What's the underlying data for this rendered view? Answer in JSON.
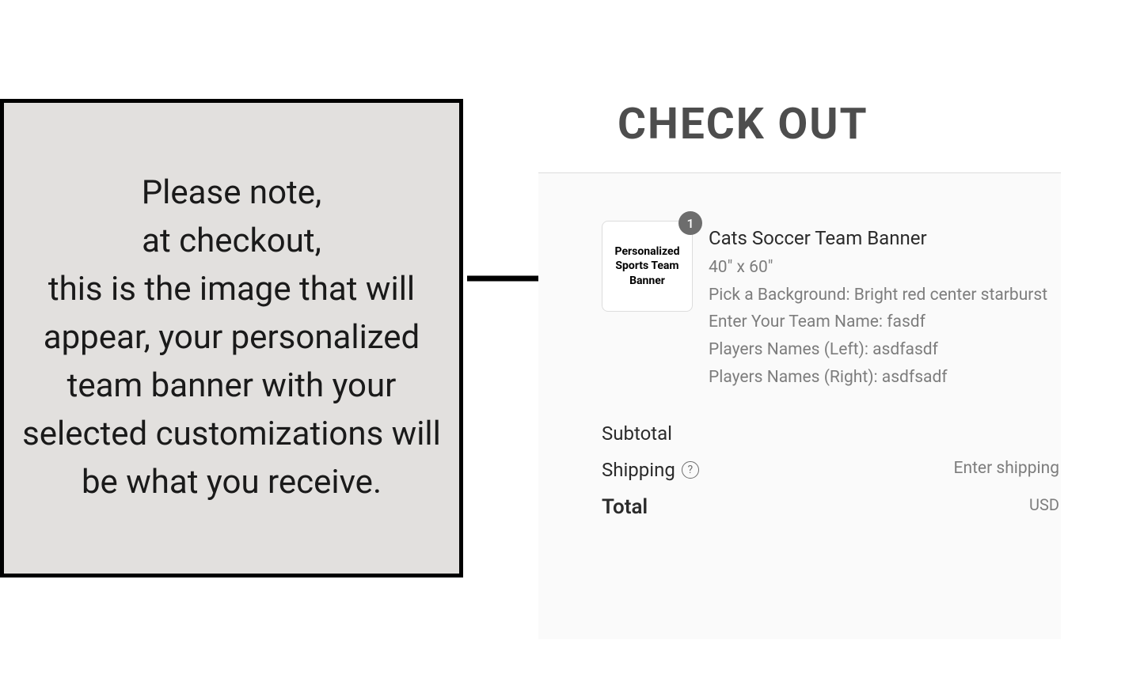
{
  "note": {
    "text": "Please note,\nat checkout,\nthis is the image that will appear, your personalized team banner  with your selected customizations will be what you receive."
  },
  "checkout": {
    "title": "CHECK OUT",
    "item": {
      "quantity": "1",
      "thumb_text": "Personalized Sports Team Banner",
      "name": "Cats Soccer Team Banner",
      "size": "40\" x 60\"",
      "background": "Pick a Background: Bright red center starburst",
      "team_name": "Enter Your Team Name: fasdf",
      "players_left": "Players Names (Left): asdfasdf",
      "players_right": "Players Names (Right): asdfsadf"
    },
    "summary": {
      "subtotal_label": "Subtotal",
      "shipping_label": "Shipping",
      "shipping_value": "Enter shipping",
      "total_label": "Total",
      "total_currency": "USD"
    }
  }
}
